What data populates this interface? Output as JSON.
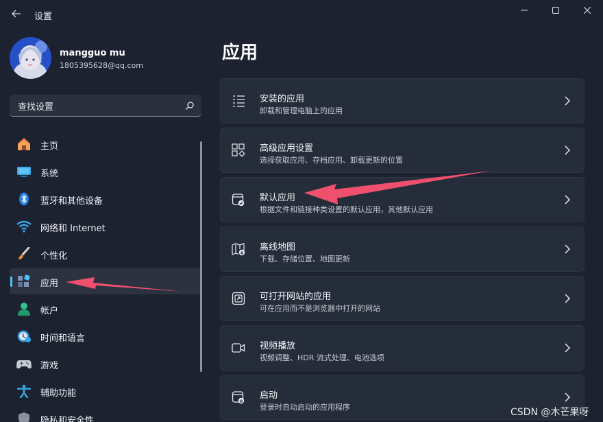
{
  "window": {
    "title": "设置",
    "back_icon": "back-arrow-icon",
    "controls": [
      "minimize-icon",
      "maximize-icon",
      "close-icon"
    ]
  },
  "profile": {
    "name": "mangguo mu",
    "email": "1805395628@qq.com",
    "avatar": "anime-avatar"
  },
  "search": {
    "placeholder": "查找设置",
    "icon": "search-icon"
  },
  "sidebar": {
    "items": [
      {
        "label": "主页",
        "icon": "home-icon",
        "active": false
      },
      {
        "label": "系统",
        "icon": "system-monitor-icon",
        "active": false
      },
      {
        "label": "蓝牙和其他设备",
        "icon": "bluetooth-icon",
        "active": false
      },
      {
        "label": "网络和 Internet",
        "icon": "wifi-icon",
        "active": false
      },
      {
        "label": "个性化",
        "icon": "paintbrush-icon",
        "active": false
      },
      {
        "label": "应用",
        "icon": "apps-icon",
        "active": true
      },
      {
        "label": "帐户",
        "icon": "account-icon",
        "active": false
      },
      {
        "label": "时间和语言",
        "icon": "time-language-icon",
        "active": false
      },
      {
        "label": "游戏",
        "icon": "gamepad-icon",
        "active": false
      },
      {
        "label": "辅助功能",
        "icon": "accessibility-icon",
        "active": false
      },
      {
        "label": "隐私和安全性",
        "icon": "shield-icon",
        "active": false
      }
    ]
  },
  "main": {
    "title": "应用",
    "cards": [
      {
        "title": "安装的应用",
        "subtitle": "卸载和管理电脑上的应用",
        "icon": "installed-apps-icon"
      },
      {
        "title": "高级应用设置",
        "subtitle": "选择获取应用、存档应用、卸载更新的位置",
        "icon": "advanced-app-settings-icon"
      },
      {
        "title": "默认应用",
        "subtitle": "根据文件和链接种类设置的默认应用，其他默认应用",
        "icon": "default-apps-icon"
      },
      {
        "title": "离线地图",
        "subtitle": "下载、存储位置、地图更新",
        "icon": "offline-maps-icon"
      },
      {
        "title": "可打开网站的应用",
        "subtitle": "可在应用而不是浏览器中打开的网站",
        "icon": "apps-for-websites-icon"
      },
      {
        "title": "视频播放",
        "subtitle": "视频调整、HDR 流式处理、电池选项",
        "icon": "video-playback-icon"
      },
      {
        "title": "启动",
        "subtitle": "登录时自动启动的应用程序",
        "icon": "startup-icon"
      }
    ]
  },
  "watermark": "CSDN @木芒果呀",
  "colors": {
    "background": "#1c2230",
    "card": "#262d3a",
    "accent": "#4cc2ff",
    "annotation_arrow": "#f0506e"
  }
}
